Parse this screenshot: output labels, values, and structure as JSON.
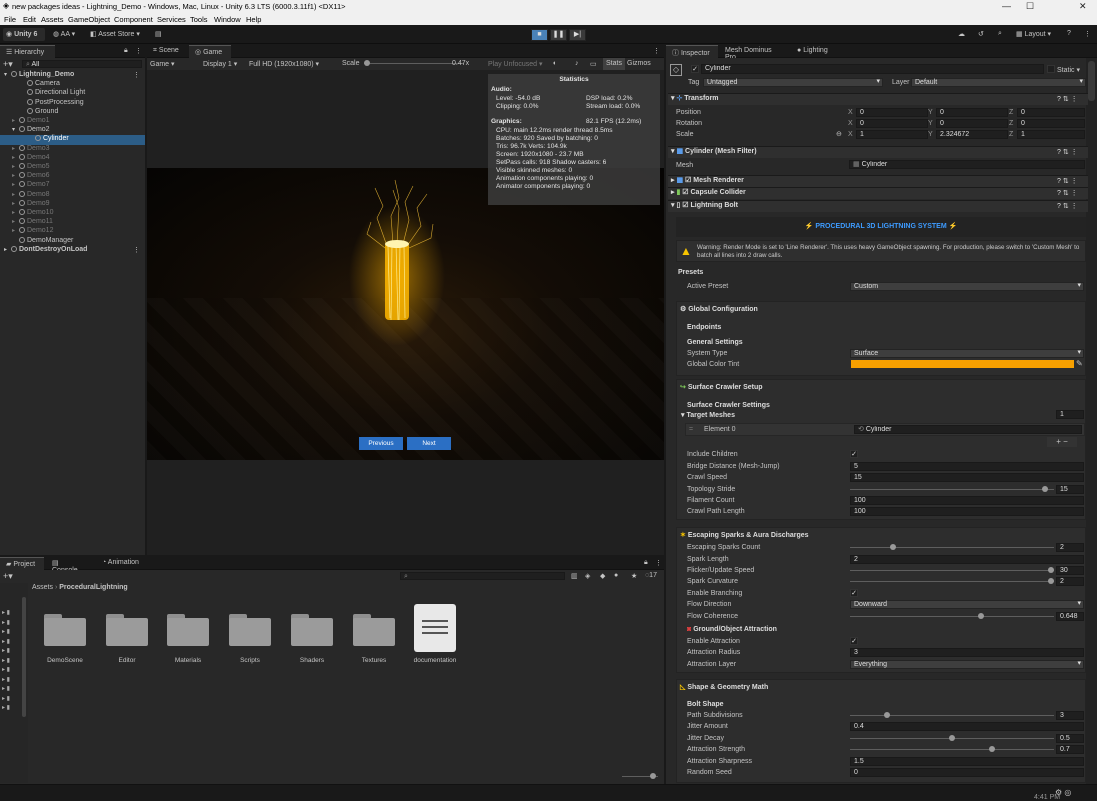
{
  "window": {
    "title": "new packages ideas - Lightning_Demo - Windows, Mac, Linux - Unity 6.3 LTS (6000.3.11f1) <DX11>"
  },
  "menu": [
    "File",
    "Edit",
    "Assets",
    "GameObject",
    "Component",
    "Services",
    "Tools",
    "Window",
    "Help"
  ],
  "toolbar": {
    "account": "Unity 6",
    "aa": "AA",
    "asset_store": "Asset Store",
    "layout": "Layout"
  },
  "hierarchy": {
    "tab": "Hierarchy",
    "search": "All",
    "items": [
      {
        "label": "Lightning_Demo",
        "indent": 0,
        "style": "scene"
      },
      {
        "label": "Camera",
        "indent": 2,
        "style": "normal"
      },
      {
        "label": "Directional Light",
        "indent": 2,
        "style": "normal"
      },
      {
        "label": "PostProcessing",
        "indent": 2,
        "style": "normal"
      },
      {
        "label": "Ground",
        "indent": 2,
        "style": "normal"
      },
      {
        "label": "Demo1",
        "indent": 1,
        "style": "dim"
      },
      {
        "label": "Demo2",
        "indent": 1,
        "style": "normal"
      },
      {
        "label": "Cylinder",
        "indent": 3,
        "style": "sel"
      },
      {
        "label": "Demo3",
        "indent": 1,
        "style": "dim"
      },
      {
        "label": "Demo4",
        "indent": 1,
        "style": "dim"
      },
      {
        "label": "Demo5",
        "indent": 1,
        "style": "dim"
      },
      {
        "label": "Demo6",
        "indent": 1,
        "style": "dim"
      },
      {
        "label": "Demo7",
        "indent": 1,
        "style": "dim"
      },
      {
        "label": "Demo8",
        "indent": 1,
        "style": "dim"
      },
      {
        "label": "Demo9",
        "indent": 1,
        "style": "dim"
      },
      {
        "label": "Demo10",
        "indent": 1,
        "style": "dim"
      },
      {
        "label": "Demo11",
        "indent": 1,
        "style": "dim"
      },
      {
        "label": "Demo12",
        "indent": 1,
        "style": "dim"
      },
      {
        "label": "DemoManager",
        "indent": 1,
        "style": "normal"
      },
      {
        "label": "DontDestroyOnLoad",
        "indent": 0,
        "style": "scene"
      }
    ]
  },
  "game": {
    "tabs": [
      "Scene",
      "Game"
    ],
    "view": "Game",
    "display": "Display 1",
    "resolution": "Full HD (1920x1080)",
    "scale_label": "Scale",
    "scale_value": "0.47x",
    "play": "Play Unfocused",
    "stats": "Stats",
    "gizmos": "Gizmos",
    "buttons": {
      "prev": "Previous",
      "next": "Next"
    },
    "statistics": {
      "title": "Statistics",
      "audio_label": "Audio:",
      "level": "Level: -54.0 dB",
      "dsp": "DSP load: 0.2%",
      "clipping": "Clipping: 0.0%",
      "stream": "Stream load: 0.0%",
      "graphics_label": "Graphics:",
      "fps": "82.1 FPS (12.2ms)",
      "cpu": "CPU: main 12.2ms  render thread 8.5ms",
      "batches": "Batches: 920   Saved by batching: 0",
      "tris": "Tris: 96.7k        Verts: 104.9k",
      "screen": "Screen: 1920x1080 - 23.7 MB",
      "setpass": "SetPass calls: 918    Shadow casters: 6",
      "skinned": "Visible skinned meshes: 0",
      "anim": "Animation components playing: 0",
      "animator": "Animator components playing: 0"
    }
  },
  "project": {
    "tabs": [
      "Project",
      "Console",
      "Animation"
    ],
    "breadcrumb": [
      "Assets",
      "ProceduralLightning"
    ],
    "count": "17",
    "items": [
      "DemoScene",
      "Editor",
      "Materials",
      "Scripts",
      "Shaders",
      "Textures",
      "documentation"
    ]
  },
  "inspector": {
    "tabs": [
      "Inspector",
      "Mesh Dominus Pro",
      "Lighting"
    ],
    "name": "Cylinder",
    "static": "Static",
    "tag_label": "Tag",
    "tag": "Untagged",
    "layer_label": "Layer",
    "layer": "Default",
    "transform": {
      "title": "Transform",
      "position_label": "Position",
      "rotation_label": "Rotation",
      "scale_label": "Scale",
      "pos": [
        "0",
        "0",
        "0"
      ],
      "rot": [
        "0",
        "0",
        "0"
      ],
      "scale": [
        "1",
        "2.324672",
        "1"
      ]
    },
    "meshfilter": {
      "title": "Cylinder (Mesh Filter)",
      "mesh_label": "Mesh",
      "mesh": "Cylinder"
    },
    "components": [
      "Mesh Renderer",
      "Capsule Collider",
      "Lightning Bolt"
    ],
    "banner": "PROCEDURAL 3D LIGHTNING SYSTEM",
    "warning": "Warning: Render Mode is set to 'Line Renderer'. This uses heavy GameObject spawning. For production, please switch to 'Custom Mesh' to batch all lines into 2 draw calls.",
    "presets": {
      "title": "Presets",
      "active_label": "Active Preset",
      "active": "Custom"
    },
    "global": {
      "title": "Global Configuration",
      "endpoints": "Endpoints",
      "general": "General Settings",
      "system_type_label": "System Type",
      "system_type": "Surface",
      "tint_label": "Global Color Tint",
      "tint_color": "#f7a000"
    },
    "crawler": {
      "title": "Surface Crawler Setup",
      "settings": "Surface Crawler Settings",
      "target_label": "Target Meshes",
      "target_count": "1",
      "element_label": "Element 0",
      "element": "Cylinder",
      "include_children": "Include Children",
      "bridge_label": "Bridge Distance (Mesh-Jump)",
      "bridge": "5",
      "crawl_label": "Crawl Speed",
      "crawl": "15",
      "topology_label": "Topology Stride",
      "topology": "15",
      "topology_frac": 0.97,
      "filament_label": "Filament Count",
      "filament": "100",
      "path_label": "Crawl Path Length",
      "path": "100"
    },
    "sparks": {
      "title": "Escaping Sparks & Aura Discharges",
      "count_label": "Escaping Sparks Count",
      "count": "2",
      "count_frac": 0.2,
      "length_label": "Spark Length",
      "length": "2",
      "flicker_label": "Flicker/Update Speed",
      "flicker": "30",
      "flicker_frac": 1.0,
      "curv_label": "Spark Curvature",
      "curv": "2",
      "curv_frac": 1.0,
      "branch_label": "Enable Branching",
      "dir_label": "Flow Direction",
      "dir": "Downward",
      "coh_label": "Flow Coherence",
      "coh": "0.648",
      "coh_frac": 0.648,
      "attraction_title": "Ground/Object Attraction",
      "enable_attr_label": "Enable Attraction",
      "radius_label": "Attraction Radius",
      "radius": "3",
      "layer_label": "Attraction Layer",
      "layer": "Everything"
    },
    "shape": {
      "title": "Shape & Geometry Math",
      "bolt": "Bolt Shape",
      "subdiv_label": "Path Subdivisions",
      "subdiv": "3",
      "subdiv_frac": 0.17,
      "jitter_label": "Jitter Amount",
      "jitter": "0.4",
      "decay_label": "Jitter Decay",
      "decay": "0.5",
      "decay_frac": 0.5,
      "astr_label": "Attraction Strength",
      "astr": "0.7",
      "astr_frac": 0.7,
      "asharp_label": "Attraction Sharpness",
      "asharp": "1.5",
      "seed_label": "Random Seed",
      "seed": "0"
    }
  },
  "status": {
    "time": "4:41 PM"
  }
}
